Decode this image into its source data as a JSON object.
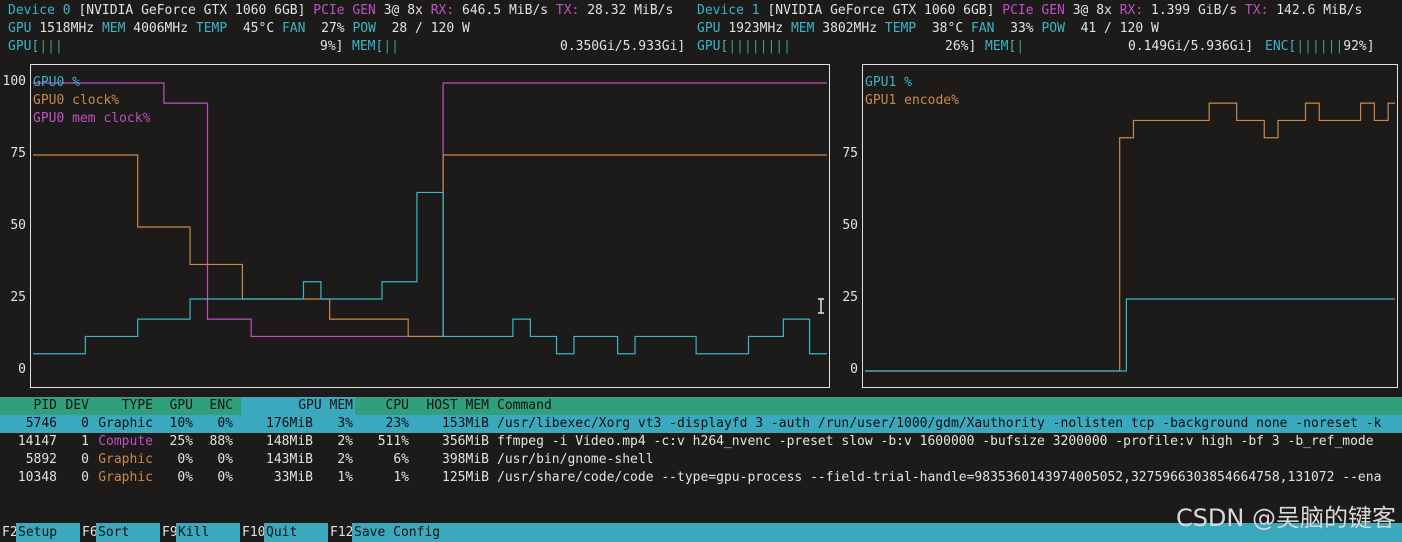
{
  "colors": {
    "cyan": "#3cb4c8",
    "purple": "#c04fc4",
    "orange": "#c8894a",
    "green": "#3ba383",
    "header_bg": "#2f9f7e",
    "selected_bg": "#3aa9be",
    "bg": "#1c1b1a"
  },
  "dev0": {
    "title": "Device 0",
    "model": "[NVIDIA GeForce GTX 1060 6GB]",
    "pcie": "PCIe",
    "gen": "GEN",
    "gen_val": "3@ 8x",
    "rx": "RX:",
    "rx_val": "646.5 MiB/s",
    "tx": "TX:",
    "tx_val": "28.32 MiB/s",
    "gpu": "GPU",
    "gpu_clk": "1518MHz",
    "mem": "MEM",
    "mem_clk": "4006MHz",
    "temp": "TEMP",
    "temp_val": "45°C",
    "fan": "FAN",
    "fan_val": "27%",
    "pow": "POW",
    "pow_val": "28 / 120 W",
    "gpu_bar_label": "GPU[",
    "gpu_bar": "|||",
    "gpu_pct": "9%]",
    "mem_bar_label": "MEM[",
    "mem_bar": "||",
    "mem_val": "0.350Gi/5.933Gi]"
  },
  "dev1": {
    "title": "Device 1",
    "model": "[NVIDIA GeForce GTX 1060 6GB]",
    "pcie": "PCIe",
    "gen": "GEN",
    "gen_val": "3@ 8x",
    "rx": "RX:",
    "rx_val": "1.399 GiB/s",
    "tx": "TX:",
    "tx_val": "142.6 MiB/s",
    "gpu": "GPU",
    "gpu_clk": "1923MHz",
    "mem": "MEM",
    "mem_clk": "3802MHz",
    "temp": "TEMP",
    "temp_val": "38°C",
    "fan": "FAN",
    "fan_val": "33%",
    "pow": "POW",
    "pow_val": "41 / 120 W",
    "gpu_bar_label": "GPU[",
    "gpu_bar": "||||||||",
    "gpu_pct": "26%]",
    "mem_bar_label": "MEM[",
    "mem_bar": "|",
    "mem_val": "0.149Gi/5.936Gi]",
    "enc_bar_label": "ENC[",
    "enc_bar": "||||||",
    "enc_pct": "92%]"
  },
  "chart_data": [
    {
      "type": "line",
      "y_ticks": [
        "100",
        "75",
        "50",
        "25",
        "0"
      ],
      "ylim": [
        0,
        100
      ],
      "series": [
        {
          "name": "GPU0 %",
          "color": "#3cb4c8",
          "values": [
            6,
            6,
            6,
            6,
            6,
            6,
            12,
            12,
            12,
            12,
            12,
            12,
            18,
            18,
            18,
            18,
            18,
            18,
            25,
            25,
            25,
            25,
            25,
            25,
            25,
            25,
            25,
            25,
            25,
            25,
            25,
            31,
            31,
            25,
            25,
            25,
            25,
            25,
            25,
            25,
            31,
            31,
            31,
            31,
            62,
            62,
            62,
            12,
            12,
            12,
            12,
            12,
            12,
            12,
            12,
            18,
            18,
            12,
            12,
            12,
            6,
            6,
            12,
            12,
            12,
            12,
            12,
            6,
            6,
            12,
            12,
            12,
            12,
            12,
            12,
            12,
            6,
            6,
            6,
            6,
            6,
            6,
            12,
            12,
            12,
            12,
            18,
            18,
            18,
            6,
            6
          ]
        },
        {
          "name": "GPU0 clock%",
          "color": "#c8894a",
          "values": [
            75,
            75,
            75,
            75,
            75,
            75,
            75,
            75,
            75,
            75,
            75,
            75,
            50,
            50,
            50,
            50,
            50,
            50,
            37,
            37,
            37,
            37,
            37,
            37,
            25,
            25,
            25,
            25,
            25,
            25,
            25,
            25,
            25,
            25,
            18,
            18,
            18,
            18,
            18,
            18,
            18,
            18,
            18,
            12,
            12,
            12,
            12,
            75,
            75,
            75,
            75,
            75,
            75,
            75,
            75,
            75,
            75,
            75,
            75,
            75,
            75,
            75,
            75,
            75,
            75,
            75,
            75,
            75,
            75,
            75,
            75,
            75,
            75,
            75,
            75,
            75,
            75,
            75,
            75,
            75,
            75,
            75,
            75,
            75,
            75,
            75,
            75,
            75,
            75,
            75,
            75
          ]
        },
        {
          "name": "GPU0 mem clock%",
          "color": "#c04fc4",
          "values": [
            100,
            100,
            100,
            100,
            100,
            100,
            100,
            100,
            100,
            100,
            100,
            100,
            100,
            100,
            100,
            93,
            93,
            93,
            93,
            93,
            18,
            18,
            18,
            18,
            18,
            12,
            12,
            12,
            12,
            12,
            12,
            12,
            12,
            12,
            12,
            12,
            12,
            12,
            12,
            12,
            12,
            12,
            12,
            12,
            12,
            12,
            12,
            100,
            100,
            100,
            100,
            100,
            100,
            100,
            100,
            100,
            100,
            100,
            100,
            100,
            100,
            100,
            100,
            100,
            100,
            100,
            100,
            100,
            100,
            100,
            100,
            100,
            100,
            100,
            100,
            100,
            100,
            100,
            100,
            100,
            100,
            100,
            100,
            100,
            100,
            100,
            100,
            100,
            100,
            100,
            100
          ]
        }
      ]
    },
    {
      "type": "line",
      "y_ticks": [
        "75",
        "50",
        "25",
        "0"
      ],
      "ylim": [
        0,
        100
      ],
      "series": [
        {
          "name": "GPU1 %",
          "color": "#3cb4c8",
          "values": [
            0,
            0,
            0,
            0,
            0,
            0,
            0,
            0,
            0,
            0,
            0,
            0,
            0,
            0,
            0,
            0,
            0,
            0,
            0,
            0,
            0,
            0,
            0,
            0,
            0,
            0,
            0,
            0,
            0,
            0,
            0,
            0,
            0,
            0,
            0,
            0,
            25,
            25,
            25,
            25,
            25,
            25,
            25,
            25,
            25,
            25,
            25,
            25,
            25,
            25,
            25,
            25,
            25,
            25,
            25,
            25,
            25,
            25,
            25,
            25,
            25,
            25,
            25,
            25,
            25,
            25,
            25,
            25,
            25,
            25,
            25,
            25,
            25
          ]
        },
        {
          "name": "GPU1 encode%",
          "color": "#c8894a",
          "values": [
            0,
            0,
            0,
            0,
            0,
            0,
            0,
            0,
            0,
            0,
            0,
            0,
            0,
            0,
            0,
            0,
            0,
            0,
            0,
            0,
            0,
            0,
            0,
            0,
            0,
            0,
            0,
            0,
            0,
            0,
            0,
            0,
            0,
            0,
            0,
            0,
            0,
            81,
            81,
            87,
            87,
            87,
            87,
            87,
            87,
            87,
            87,
            87,
            87,
            87,
            93,
            93,
            93,
            93,
            87,
            87,
            87,
            87,
            81,
            81,
            87,
            87,
            87,
            87,
            93,
            93,
            87,
            87,
            87,
            87,
            87,
            87,
            93,
            93,
            87,
            87,
            93
          ]
        }
      ]
    }
  ],
  "proc_header": {
    "pid": "PID",
    "dev": "DEV",
    "type": "TYPE",
    "gpu": "GPU",
    "enc": "ENC",
    "gpu_mem": "GPU MEM",
    "cpu": "CPU",
    "host_mem": "HOST MEM",
    "command": "Command"
  },
  "processes": [
    {
      "pid": "5746",
      "dev": "0",
      "type": "Graphic",
      "gpu": "10%",
      "enc": "0%",
      "gmem": "176MiB",
      "gmem_pct": "3%",
      "cpu": "23%",
      "hmem": "153MiB",
      "cmd": "/usr/libexec/Xorg vt3 -displayfd 3 -auth /run/user/1000/gdm/Xauthority -nolisten tcp -background none -noreset -k"
    },
    {
      "pid": "14147",
      "dev": "1",
      "type": "Compute",
      "gpu": "25%",
      "enc": "88%",
      "gmem": "148MiB",
      "gmem_pct": "2%",
      "cpu": "511%",
      "hmem": "356MiB",
      "cmd": "ffmpeg -i Video.mp4 -c:v h264_nvenc -preset slow -b:v 1600000 -bufsize 3200000 -profile:v high -bf 3 -b_ref_mode"
    },
    {
      "pid": "5892",
      "dev": "0",
      "type": "Graphic",
      "gpu": "0%",
      "enc": "0%",
      "gmem": "143MiB",
      "gmem_pct": "2%",
      "cpu": "6%",
      "hmem": "398MiB",
      "cmd": "/usr/bin/gnome-shell"
    },
    {
      "pid": "10348",
      "dev": "0",
      "type": "Graphic",
      "gpu": "0%",
      "enc": "0%",
      "gmem": "33MiB",
      "gmem_pct": "1%",
      "cpu": "1%",
      "hmem": "125MiB",
      "cmd": "/usr/share/code/code --type=gpu-process --field-trial-handle=9835360143974005052,3275966303854664758,131072 --ena"
    }
  ],
  "footer": [
    {
      "key": "F2",
      "label": "Setup"
    },
    {
      "key": "F6",
      "label": "Sort"
    },
    {
      "key": "F9",
      "label": "Kill"
    },
    {
      "key": "F10",
      "label": "Quit"
    },
    {
      "key": "F12",
      "label": "Save Config"
    }
  ],
  "watermark": "CSDN @吴脑的键客"
}
